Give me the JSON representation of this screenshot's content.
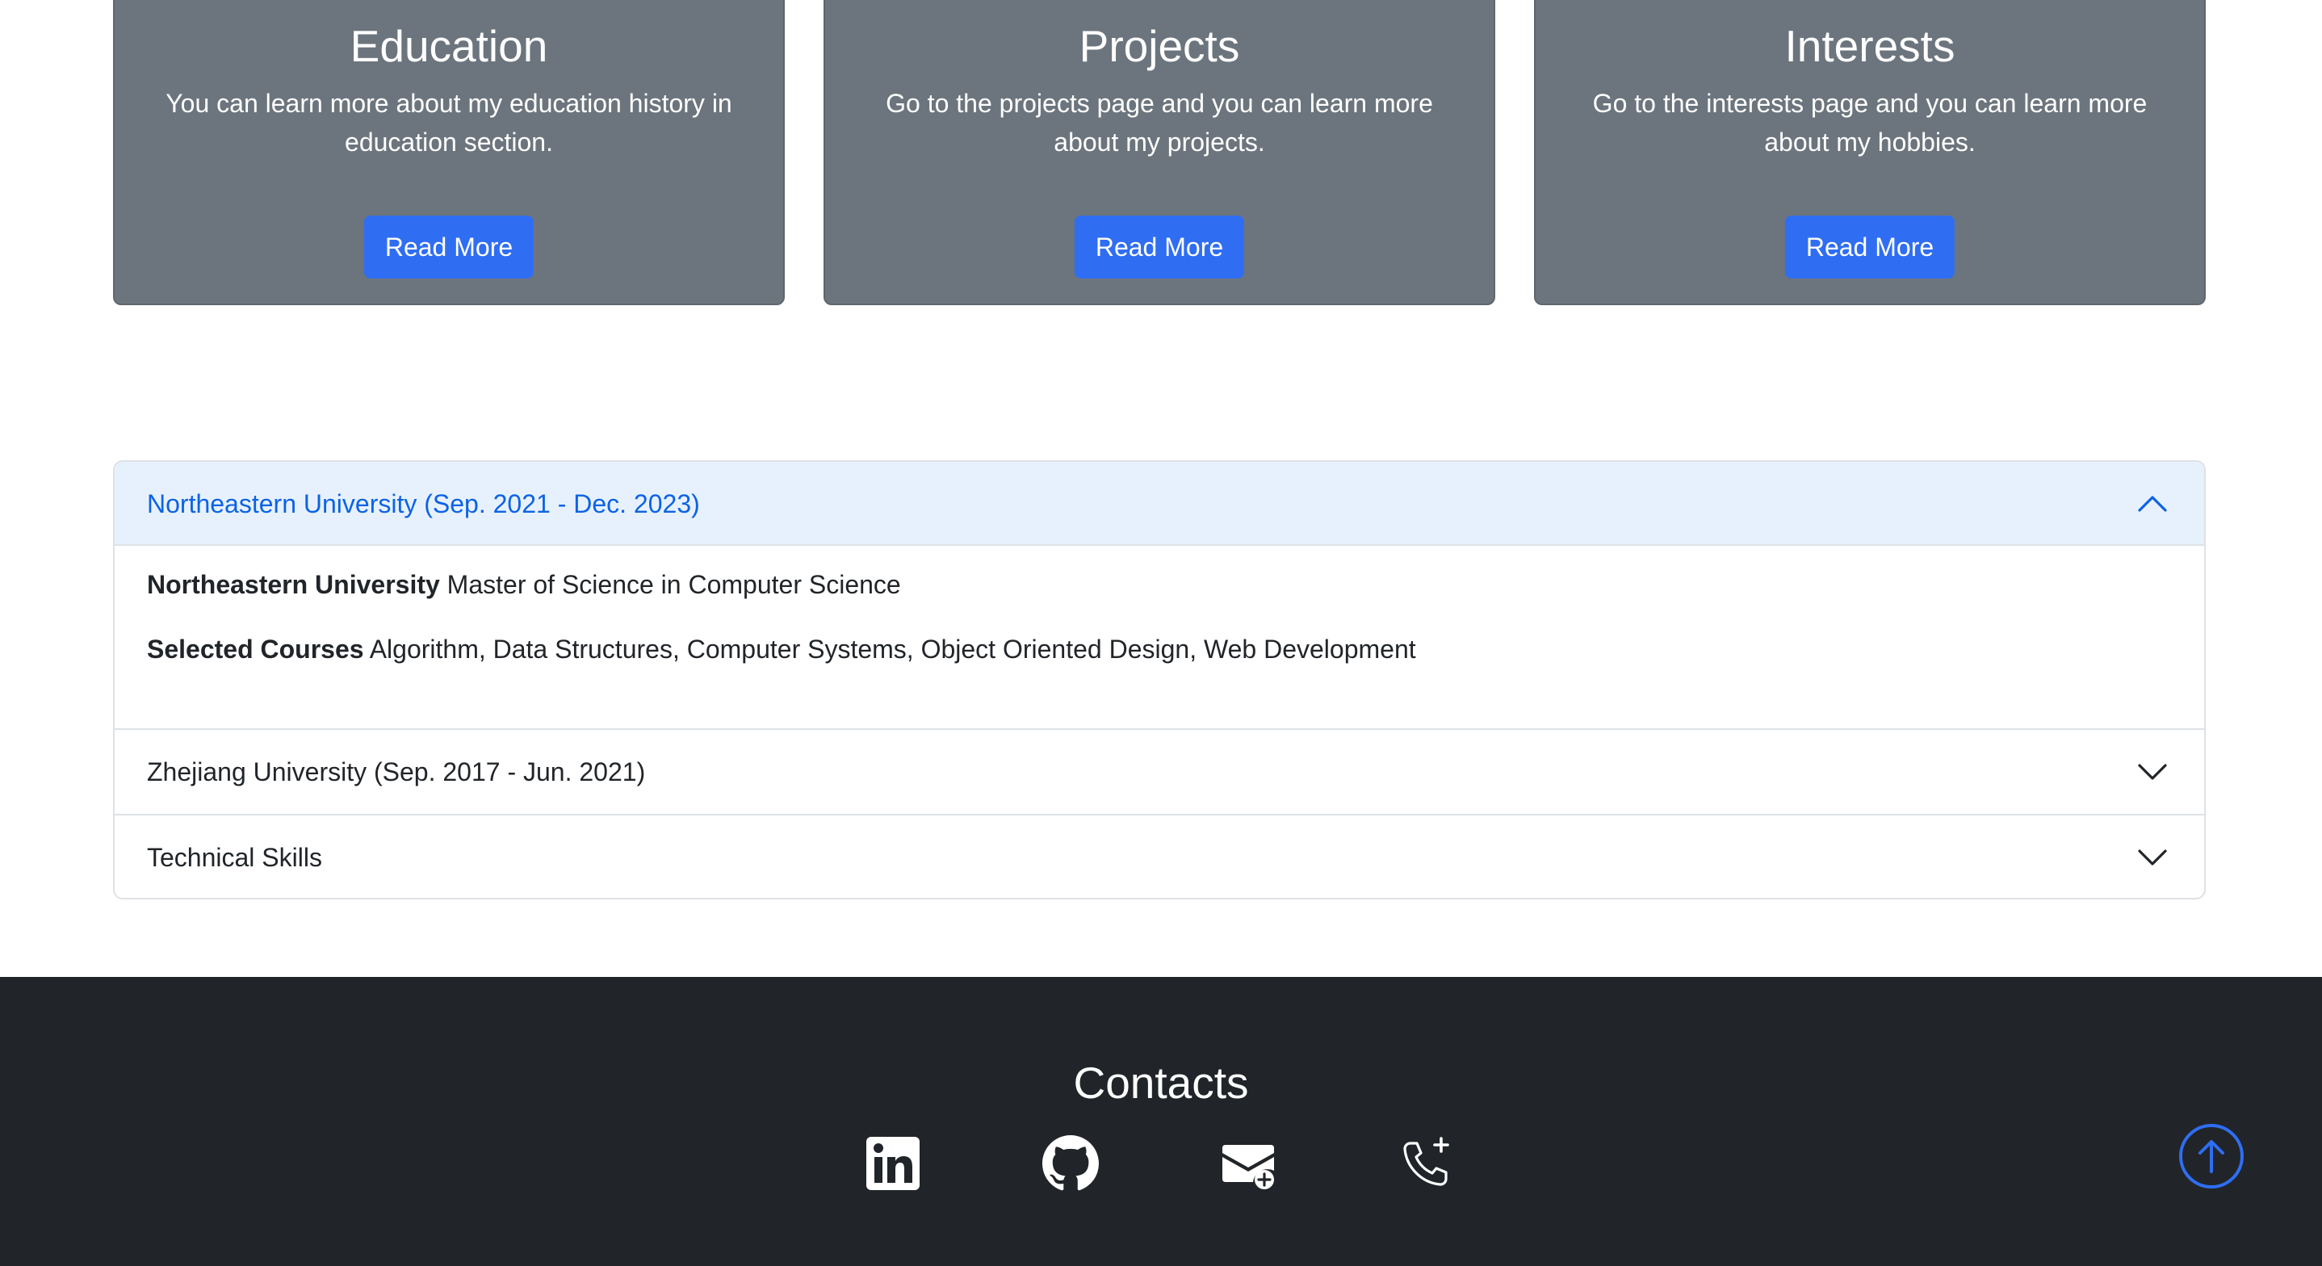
{
  "cards": [
    {
      "title": "Education",
      "text": "You can learn more about my education history in education section.",
      "button_label": "Read More"
    },
    {
      "title": "Projects",
      "text": "Go to the projects page and you can learn more about my projects.",
      "button_label": "Read More"
    },
    {
      "title": "Interests",
      "text": "Go to the interests page and you can learn more about my hobbies.",
      "button_label": "Read More"
    }
  ],
  "accordion": {
    "items": [
      {
        "header": "Northeastern University (Sep. 2021 - Dec. 2023)",
        "expanded": true,
        "icon": "chevron-up-icon",
        "body": {
          "line1_bold": "Northeastern University",
          "line1_text": " Master of Science in Computer Science",
          "line2_bold": "Selected Courses",
          "line2_text": " Algorithm, Data Structures, Computer Systems, Object Oriented Design, Web Development"
        }
      },
      {
        "header": "Zhejiang University (Sep. 2017 - Jun. 2021)",
        "expanded": false,
        "icon": "chevron-down-icon"
      },
      {
        "header": "Technical Skills",
        "expanded": false,
        "icon": "chevron-down-icon"
      }
    ]
  },
  "footer": {
    "title": "Contacts",
    "icons": [
      "linkedin-icon",
      "github-icon",
      "email-add-icon",
      "phone-plus-icon"
    ]
  },
  "back_to_top": {
    "icon": "arrow-up-circle-icon"
  },
  "colors": {
    "card_bg": "#6c757d",
    "button_bg": "#2f6ef3",
    "accordion_active_bg": "#e7f1fe",
    "accordion_active_text": "#0c63e4",
    "footer_bg": "#212529",
    "back_to_top": "#2f6ef3"
  }
}
